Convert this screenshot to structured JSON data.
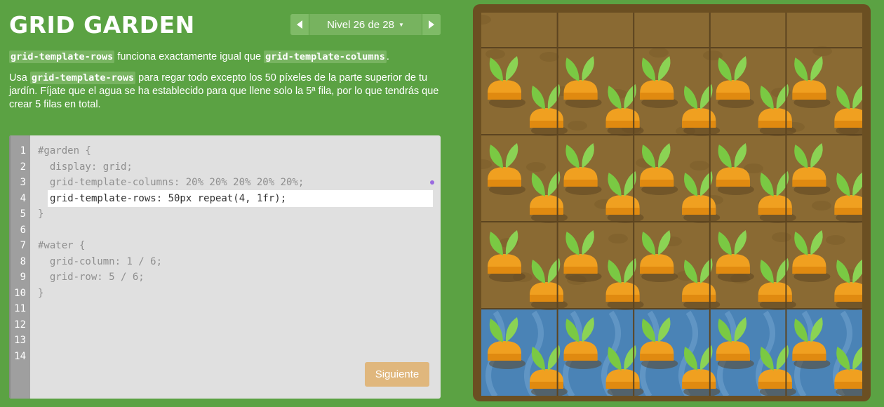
{
  "header": {
    "title": "GRID GARDEN",
    "level_label": "Nivel 26 de 28",
    "prev_icon": "chevron-left-icon",
    "next_icon": "chevron-right-icon",
    "dropdown_icon": "caret-down-icon"
  },
  "instructions": {
    "p1_code_a": "grid-template-rows",
    "p1_text": " funciona exactamente igual que ",
    "p1_code_b": "grid-template-columns",
    "p1_end": ".",
    "p2_pre": "Usa ",
    "p2_code": "grid-template-rows",
    "p2_text": " para regar todo excepto los 50 píxeles de la parte superior de tu jardín. Fíjate que el agua se ha establecido para que llene solo la 5ª fila, por lo que tendrás que crear 5 filas en total."
  },
  "editor": {
    "line_numbers": [
      "1",
      "2",
      "3",
      "4",
      "5",
      "6",
      "7",
      "8",
      "9",
      "10",
      "11",
      "12",
      "13",
      "14"
    ],
    "lines": [
      "#garden {",
      "  display: grid;",
      "  grid-template-columns: 20% 20% 20% 20% 20%;",
      "",
      "}",
      "",
      "#water {",
      "  grid-column: 1 / 6;",
      "  grid-row: 5 / 6;",
      "}",
      "",
      "",
      "",
      ""
    ],
    "input_value": "grid-template-rows: 50px repeat(4, 1fr);",
    "next_button": "Siguiente"
  },
  "colors": {
    "background": "#5ba243",
    "soil": "#8a6a33",
    "water": "#4a83b6",
    "carrot": "#f0a020",
    "leaf": "#7ac943",
    "button": "#e0b77d"
  },
  "garden": {
    "columns": [
      "20%",
      "20%",
      "20%",
      "20%",
      "20%"
    ],
    "rows": [
      "50px",
      "1fr",
      "1fr",
      "1fr",
      "1fr"
    ],
    "water_row": 5,
    "carrots_per_cell": 2
  }
}
